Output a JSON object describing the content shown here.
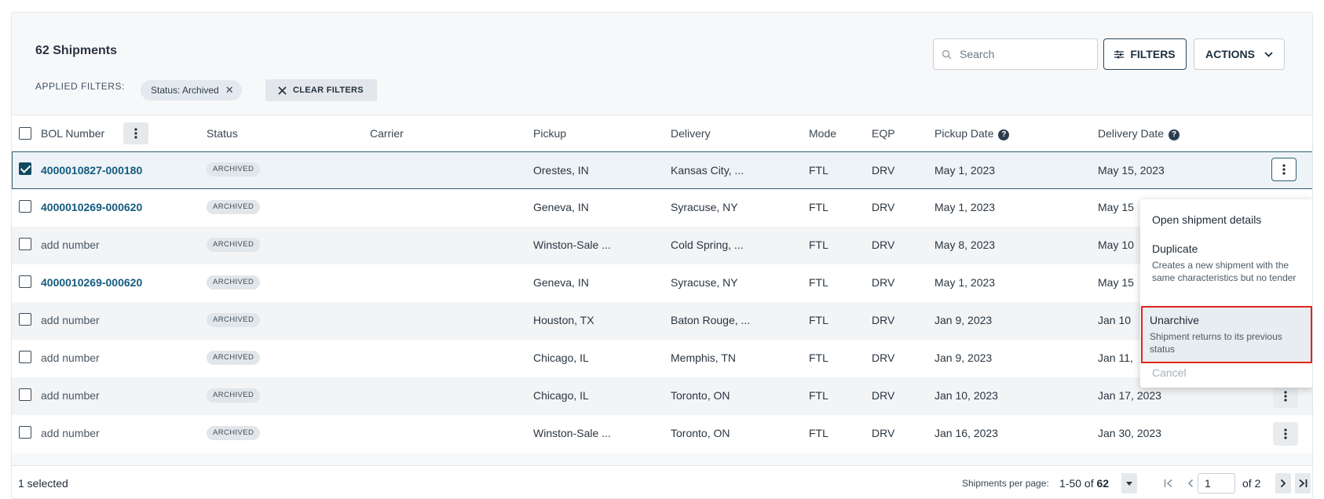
{
  "header": {
    "title": "62 Shipments",
    "applied_filters_label": "APPLIED FILTERS:",
    "filter_chip": "Status: Archived",
    "clear_filters": "CLEAR FILTERS",
    "search_placeholder": "Search",
    "filters_button": "FILTERS",
    "actions_button": "ACTIONS"
  },
  "columns": {
    "bol": "BOL Number",
    "status": "Status",
    "carrier": "Carrier",
    "pickup": "Pickup",
    "delivery": "Delivery",
    "mode": "Mode",
    "eqp": "EQP",
    "pickup_date": "Pickup Date",
    "delivery_date": "Delivery Date"
  },
  "rows": [
    {
      "bol": "4000010827-000180",
      "status": "ARCHIVED",
      "carrier": "",
      "pickup": "Orestes, IN",
      "delivery": "Kansas City, ...",
      "mode": "FTL",
      "eqp": "DRV",
      "pickup_date": "May 1, 2023",
      "delivery_date": "May 15, 2023"
    },
    {
      "bol": "4000010269-000620",
      "status": "ARCHIVED",
      "carrier": "",
      "pickup": "Geneva, IN",
      "delivery": "Syracuse, NY",
      "mode": "FTL",
      "eqp": "DRV",
      "pickup_date": "May 1, 2023",
      "delivery_date": "May 15"
    },
    {
      "bol": "add number",
      "status": "ARCHIVED",
      "carrier": "",
      "pickup": "Winston-Sale ...",
      "delivery": "Cold Spring, ...",
      "mode": "FTL",
      "eqp": "DRV",
      "pickup_date": "May 8, 2023",
      "delivery_date": "May 10"
    },
    {
      "bol": "4000010269-000620",
      "status": "ARCHIVED",
      "carrier": "",
      "pickup": "Geneva, IN",
      "delivery": "Syracuse, NY",
      "mode": "FTL",
      "eqp": "DRV",
      "pickup_date": "May 1, 2023",
      "delivery_date": "May 15"
    },
    {
      "bol": "add number",
      "status": "ARCHIVED",
      "carrier": "",
      "pickup": "Houston, TX",
      "delivery": "Baton Rouge, ...",
      "mode": "FTL",
      "eqp": "DRV",
      "pickup_date": "Jan 9, 2023",
      "delivery_date": "Jan 10"
    },
    {
      "bol": "add number",
      "status": "ARCHIVED",
      "carrier": "",
      "pickup": "Chicago, IL",
      "delivery": "Memphis, TN",
      "mode": "FTL",
      "eqp": "DRV",
      "pickup_date": "Jan 9, 2023",
      "delivery_date": "Jan 11,"
    },
    {
      "bol": "add number",
      "status": "ARCHIVED",
      "carrier": "",
      "pickup": "Chicago, IL",
      "delivery": "Toronto, ON",
      "mode": "FTL",
      "eqp": "DRV",
      "pickup_date": "Jan 10, 2023",
      "delivery_date": "Jan 17, 2023"
    },
    {
      "bol": "add number",
      "status": "ARCHIVED",
      "carrier": "",
      "pickup": "Winston-Sale ...",
      "delivery": "Toronto, ON",
      "mode": "FTL",
      "eqp": "DRV",
      "pickup_date": "Jan 16, 2023",
      "delivery_date": "Jan 30, 2023"
    }
  ],
  "context_menu": {
    "open_details": "Open shipment details",
    "duplicate_title": "Duplicate",
    "duplicate_desc": "Creates a new shipment with the same characteristics but no tender",
    "unarchive_title": "Unarchive",
    "unarchive_desc": "Shipment returns to its previous status",
    "cancel": "Cancel"
  },
  "footer": {
    "selected": "1 selected",
    "per_page_label": "Shipments per page:",
    "range_prefix": "1-50 of ",
    "range_total": "62",
    "page_input": "1",
    "of_pages": "of 2"
  },
  "colors": {
    "link": "#145b80",
    "primary": "#0f4a5f",
    "highlight_border": "#e0261f"
  }
}
